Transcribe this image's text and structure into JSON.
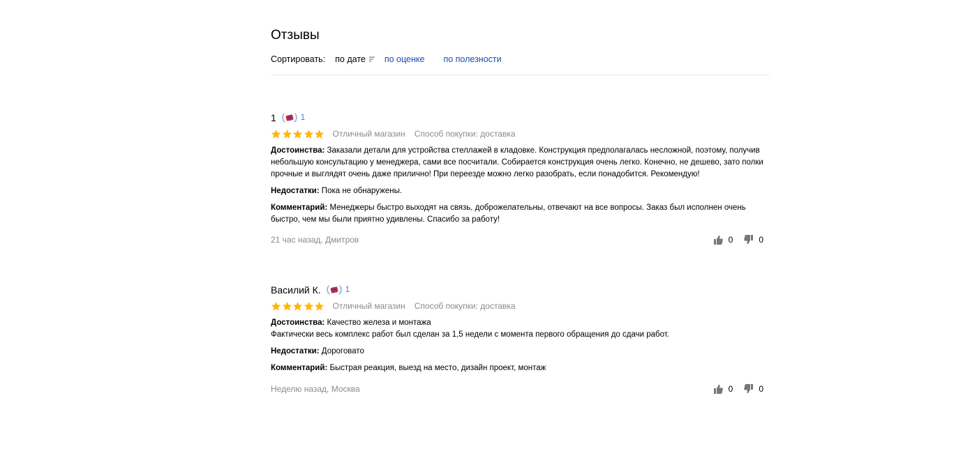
{
  "reviews_section": {
    "title": "Отзывы",
    "sort": {
      "label": "Сортировать:",
      "options": [
        "по дате",
        "по оценке",
        "по полезности"
      ],
      "selected": "по дате"
    }
  },
  "colors": {
    "star": "#ffb700",
    "link": "#1a4bb3",
    "muted": "#8a8a8a"
  },
  "reviews": [
    {
      "author": "1",
      "badge_count": "1",
      "rating": 5,
      "shop_rating_text": "Отличный магазин",
      "purchase_method": "Способ покупки: доставка",
      "pros_label": "Достоинства:",
      "pros": "Заказали детали для устройства стеллажей в кладовке. Конструкция предполагалась несложной, поэтому, получив небольшую консультацию у менеджера, сами все посчитали. Собирается конструкция очень легко. Конечно, не дешево, зато полки прочные и выглядят очень даже прилично! При переезде можно легко разобрать, если понадобится. Рекомендую!",
      "cons_label": "Недостатки:",
      "cons": "Пока не обнаружены.",
      "comment_label": "Комментарий:",
      "comment": "Менеджеры быстро выходят на связь, доброжелательны, отвечают на все вопросы. Заказ был исполнен очень быстро, чем мы были приятно удивлены. Спасибо за работу!",
      "date_location": "21 час назад, Дмитров",
      "likes": "0",
      "dislikes": "0"
    },
    {
      "author": "Василий К.",
      "badge_count": "1",
      "rating": 5,
      "shop_rating_text": "Отличный магазин",
      "purchase_method": "Способ покупки: доставка",
      "pros_label": "Достоинства:",
      "pros": "Качество железа и монтажа",
      "pros_extra": "Фактически весь комплекс работ был сделан за 1,5 недели с момента первого обращения до сдачи работ.",
      "cons_label": "Недостатки:",
      "cons": "Дороговато",
      "comment_label": "Комментарий:",
      "comment": "Быстрая реакция, выезд на место, дизайн проект, монтаж",
      "date_location": "Неделю назад, Москва",
      "likes": "0",
      "dislikes": "0"
    }
  ]
}
